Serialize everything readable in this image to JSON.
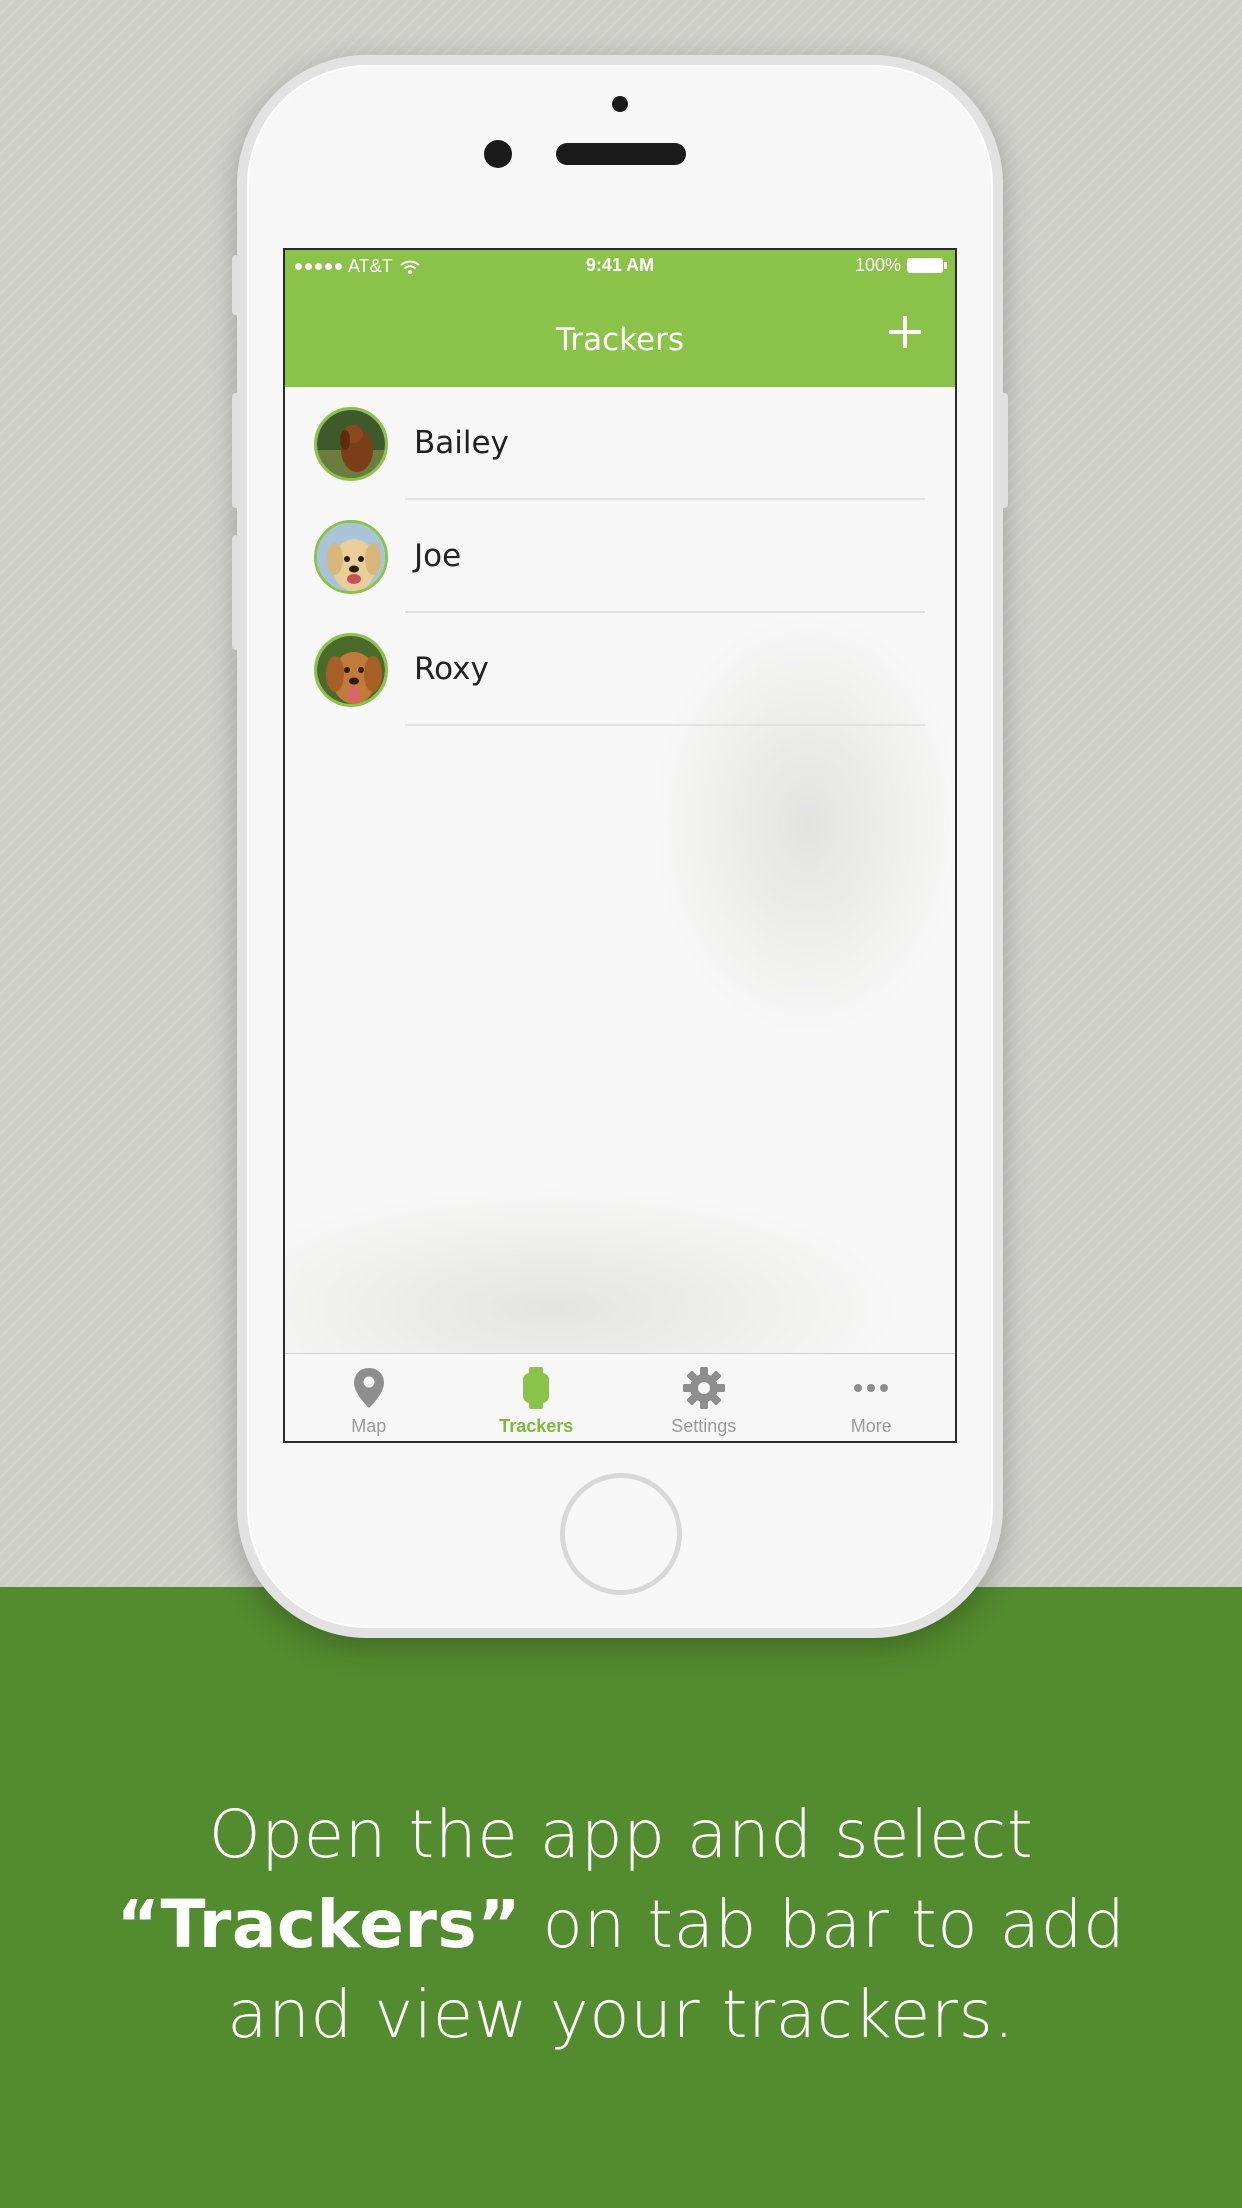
{
  "status_bar": {
    "carrier": "AT&T",
    "time": "9:41 AM",
    "battery": "100%"
  },
  "navbar": {
    "title": "Trackers",
    "add_icon": "plus-icon"
  },
  "trackers": [
    {
      "name": "Bailey",
      "avatar": "dog-photo-dark-brown"
    },
    {
      "name": "Joe",
      "avatar": "dog-photo-golden"
    },
    {
      "name": "Roxy",
      "avatar": "dog-photo-red-golden"
    }
  ],
  "tabs": [
    {
      "label": "Map",
      "icon": "map-pin-icon",
      "active": false
    },
    {
      "label": "Trackers",
      "icon": "watch-icon",
      "active": true
    },
    {
      "label": "Settings",
      "icon": "gear-icon",
      "active": false
    },
    {
      "label": "More",
      "icon": "ellipsis-icon",
      "active": false
    }
  ],
  "caption": {
    "line1": "Open the app and select",
    "line2_bold": "“Trackers”",
    "line2_rest": " on tab bar to add",
    "line3": "and view your trackers."
  },
  "colors": {
    "accent": "#8bc34a",
    "banner": "#538b2f",
    "active_tab": "#7cba3e",
    "inactive_tab": "#9a9a9a"
  }
}
